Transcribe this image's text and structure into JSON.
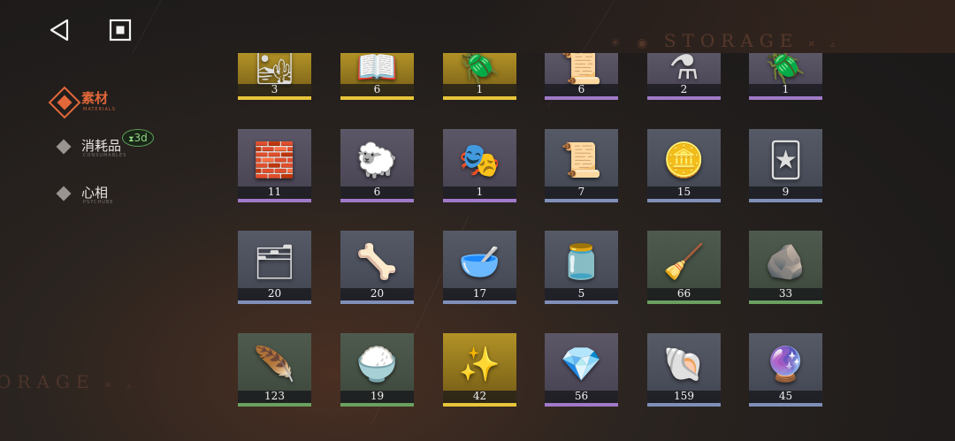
{
  "nav": {
    "back_icon": "back-triangle-icon",
    "home_icon": "square-stop-icon"
  },
  "watermark": {
    "top": "STORAGE",
    "left": "ORAGE"
  },
  "tabs": [
    {
      "cn": "素材",
      "en": "MATERIALS",
      "active": true
    },
    {
      "cn": "消耗品",
      "en": "CONSUMABLES",
      "active": false,
      "badge": "3d"
    },
    {
      "cn": "心相",
      "en": "PSYCHUBE",
      "active": false
    }
  ],
  "rarity_colors": {
    "gold": "#e8c53a",
    "purple": "#a07ac8",
    "blue": "#7f8fb8",
    "green": "#6aa060"
  },
  "items": [
    {
      "count": "3",
      "quality": "gold",
      "icon": "amber-dust-icon"
    },
    {
      "count": "6",
      "quality": "gold",
      "icon": "open-book-icon"
    },
    {
      "count": "1",
      "quality": "gold",
      "icon": "dark-relic-icon"
    },
    {
      "count": "6",
      "quality": "purple",
      "icon": "parchment-icon"
    },
    {
      "count": "2",
      "quality": "purple",
      "icon": "glass-vial-icon"
    },
    {
      "count": "1",
      "quality": "purple",
      "icon": "beetle-icon"
    },
    {
      "count": "11",
      "quality": "purple",
      "icon": "silver-ingots-icon"
    },
    {
      "count": "6",
      "quality": "purple",
      "icon": "wool-sprout-icon"
    },
    {
      "count": "1",
      "quality": "purple",
      "icon": "mask-icon"
    },
    {
      "count": "7",
      "quality": "blue",
      "icon": "scroll-seal-icon"
    },
    {
      "count": "15",
      "quality": "blue",
      "icon": "gold-coin-icon"
    },
    {
      "count": "9",
      "quality": "blue",
      "icon": "card-icon"
    },
    {
      "count": "20",
      "quality": "blue",
      "icon": "silver-bars-icon"
    },
    {
      "count": "20",
      "quality": "blue",
      "icon": "bone-bundle-icon"
    },
    {
      "count": "17",
      "quality": "blue",
      "icon": "salt-dish-icon"
    },
    {
      "count": "5",
      "quality": "blue",
      "icon": "green-jar-icon"
    },
    {
      "count": "66",
      "quality": "green",
      "icon": "broom-icon"
    },
    {
      "count": "33",
      "quality": "green",
      "icon": "silver-rock-icon"
    },
    {
      "count": "123",
      "quality": "green",
      "icon": "clay-shard-icon"
    },
    {
      "count": "19",
      "quality": "green",
      "icon": "white-grains-icon"
    },
    {
      "count": "42",
      "quality": "gold",
      "icon": "crystal-cluster-icon"
    },
    {
      "count": "56",
      "quality": "purple",
      "icon": "amber-crystal-icon"
    },
    {
      "count": "159",
      "quality": "blue",
      "icon": "seashell-icon"
    },
    {
      "count": "45",
      "quality": "blue",
      "icon": "glass-orb-icon"
    }
  ]
}
